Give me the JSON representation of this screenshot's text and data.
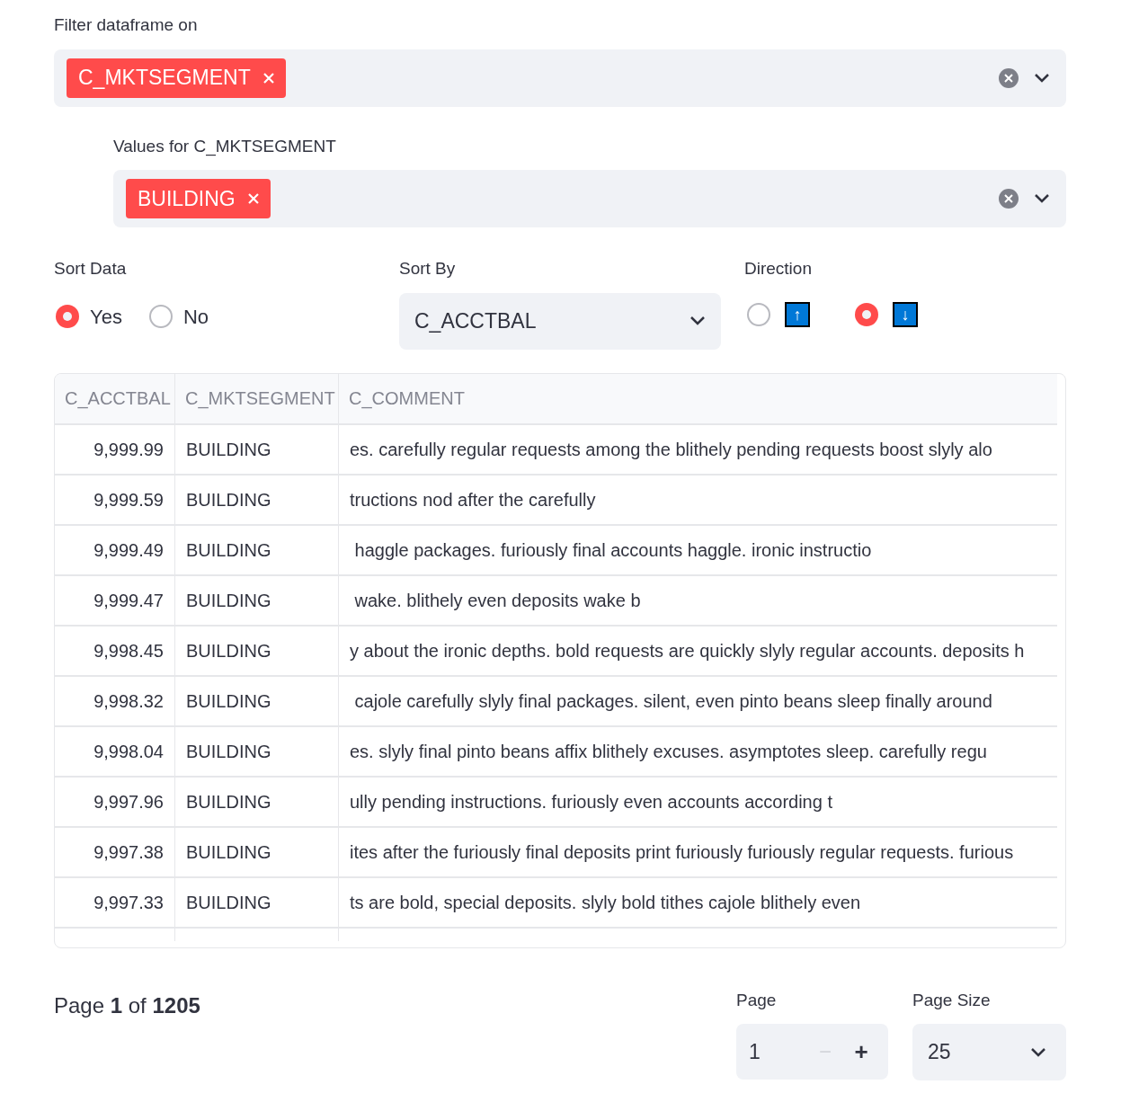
{
  "filter": {
    "label": "Filter dataframe on",
    "tags": [
      "C_MKTSEGMENT"
    ]
  },
  "values_filter": {
    "label": "Values for C_MKTSEGMENT",
    "tags": [
      "BUILDING"
    ]
  },
  "sort_data": {
    "label": "Sort Data",
    "options": [
      {
        "label": "Yes",
        "selected": true
      },
      {
        "label": "No",
        "selected": false
      }
    ]
  },
  "sort_by": {
    "label": "Sort By",
    "value": "C_ACCTBAL"
  },
  "direction": {
    "label": "Direction",
    "options": [
      {
        "label": "↑",
        "selected": false
      },
      {
        "label": "↓",
        "selected": true
      }
    ]
  },
  "table": {
    "columns": [
      "C_ACCTBAL",
      "C_MKTSEGMENT",
      "C_COMMENT"
    ],
    "rows": [
      [
        "9,999.99",
        "BUILDING",
        "es. carefully regular requests among the blithely pending requests boost slyly alo"
      ],
      [
        "9,999.59",
        "BUILDING",
        "tructions nod after the carefully"
      ],
      [
        "9,999.49",
        "BUILDING",
        " haggle packages. furiously final accounts haggle. ironic instructio"
      ],
      [
        "9,999.47",
        "BUILDING",
        " wake. blithely even deposits wake b"
      ],
      [
        "9,998.45",
        "BUILDING",
        "y about the ironic depths. bold requests are quickly slyly regular accounts. deposits h"
      ],
      [
        "9,998.32",
        "BUILDING",
        " cajole carefully slyly final packages. silent, even pinto beans sleep finally around"
      ],
      [
        "9,998.04",
        "BUILDING",
        "es. slyly final pinto beans affix blithely excuses. asymptotes sleep. carefully regu"
      ],
      [
        "9,997.96",
        "BUILDING",
        "ully pending instructions. furiously even accounts according t"
      ],
      [
        "9,997.38",
        "BUILDING",
        "ites after the furiously final deposits print furiously furiously regular requests. furious"
      ],
      [
        "9,997.33",
        "BUILDING",
        "ts are bold, special deposits. slyly bold tithes cajole blithely even"
      ]
    ]
  },
  "pagination": {
    "text": "Page **1** of **1205**"
  },
  "page": {
    "label": "Page",
    "value": "1",
    "minus": "−",
    "minus_disabled": true,
    "plus": "+"
  },
  "page_size": {
    "label": "Page Size",
    "value": "25"
  }
}
